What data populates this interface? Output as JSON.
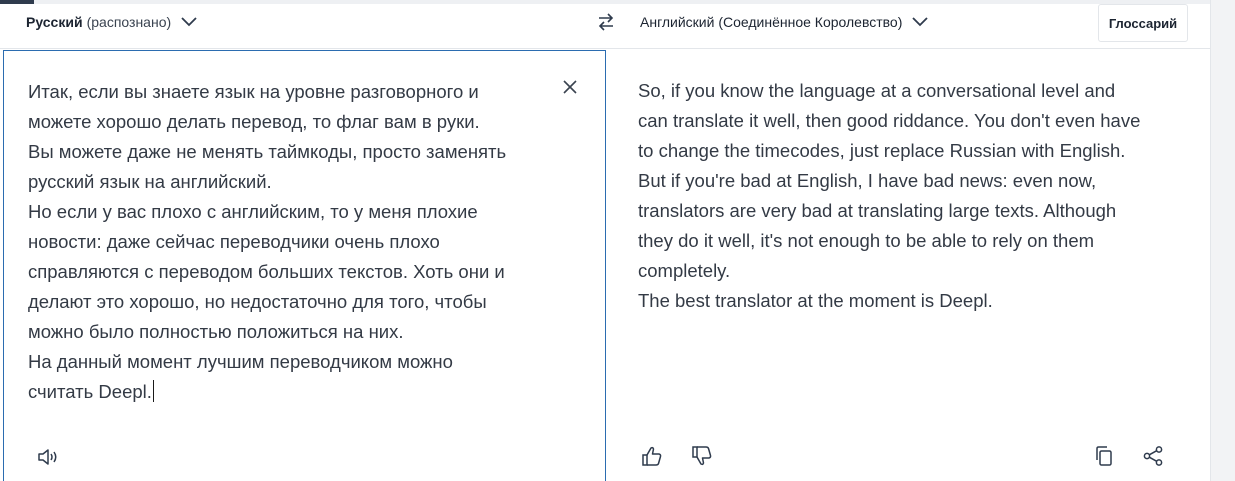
{
  "header": {
    "source_lang": "Русский",
    "source_detected": "(распознано)",
    "target_lang": "Английский (Соединённое Королевство)",
    "glossary_label": "Глоссарий"
  },
  "source": {
    "text": "Итак, если вы знаете язык на уровне разговорного и\nможете хорошо делать перевод, то флаг вам в руки.\nВы можете даже не менять таймкоды, просто заменять\nрусский язык на английский.\nНо если у вас плохо с английским, то у меня плохие\nновости: даже сейчас переводчики очень плохо\nсправляются с переводом больших текстов. Хоть они и\nделают это хорошо, но недостаточно для того, чтобы\nможно было полностью положиться на них.\nНа данный момент лучшим переводчиком можно\nсчитать Deepl."
  },
  "target": {
    "text": "So, if you know the language at a conversational level and\ncan translate it well, then good riddance. You don't even have\nto change the timecodes, just replace Russian with English.\nBut if you're bad at English, I have bad news: even now,\ntranslators are very bad at translating large texts. Although\nthey do it well, it's not enough to be able to rely on them\ncompletely.\nThe best translator at the moment is Deepl."
  },
  "icons": [
    "chevron-down-icon",
    "swap-icon",
    "close-icon",
    "speaker-icon",
    "thumbs-up-icon",
    "thumbs-down-icon",
    "copy-icon",
    "share-icon"
  ],
  "colors": {
    "accent_border": "#2b6cb0",
    "text": "#333a45",
    "icon": "#2f3b4d"
  }
}
